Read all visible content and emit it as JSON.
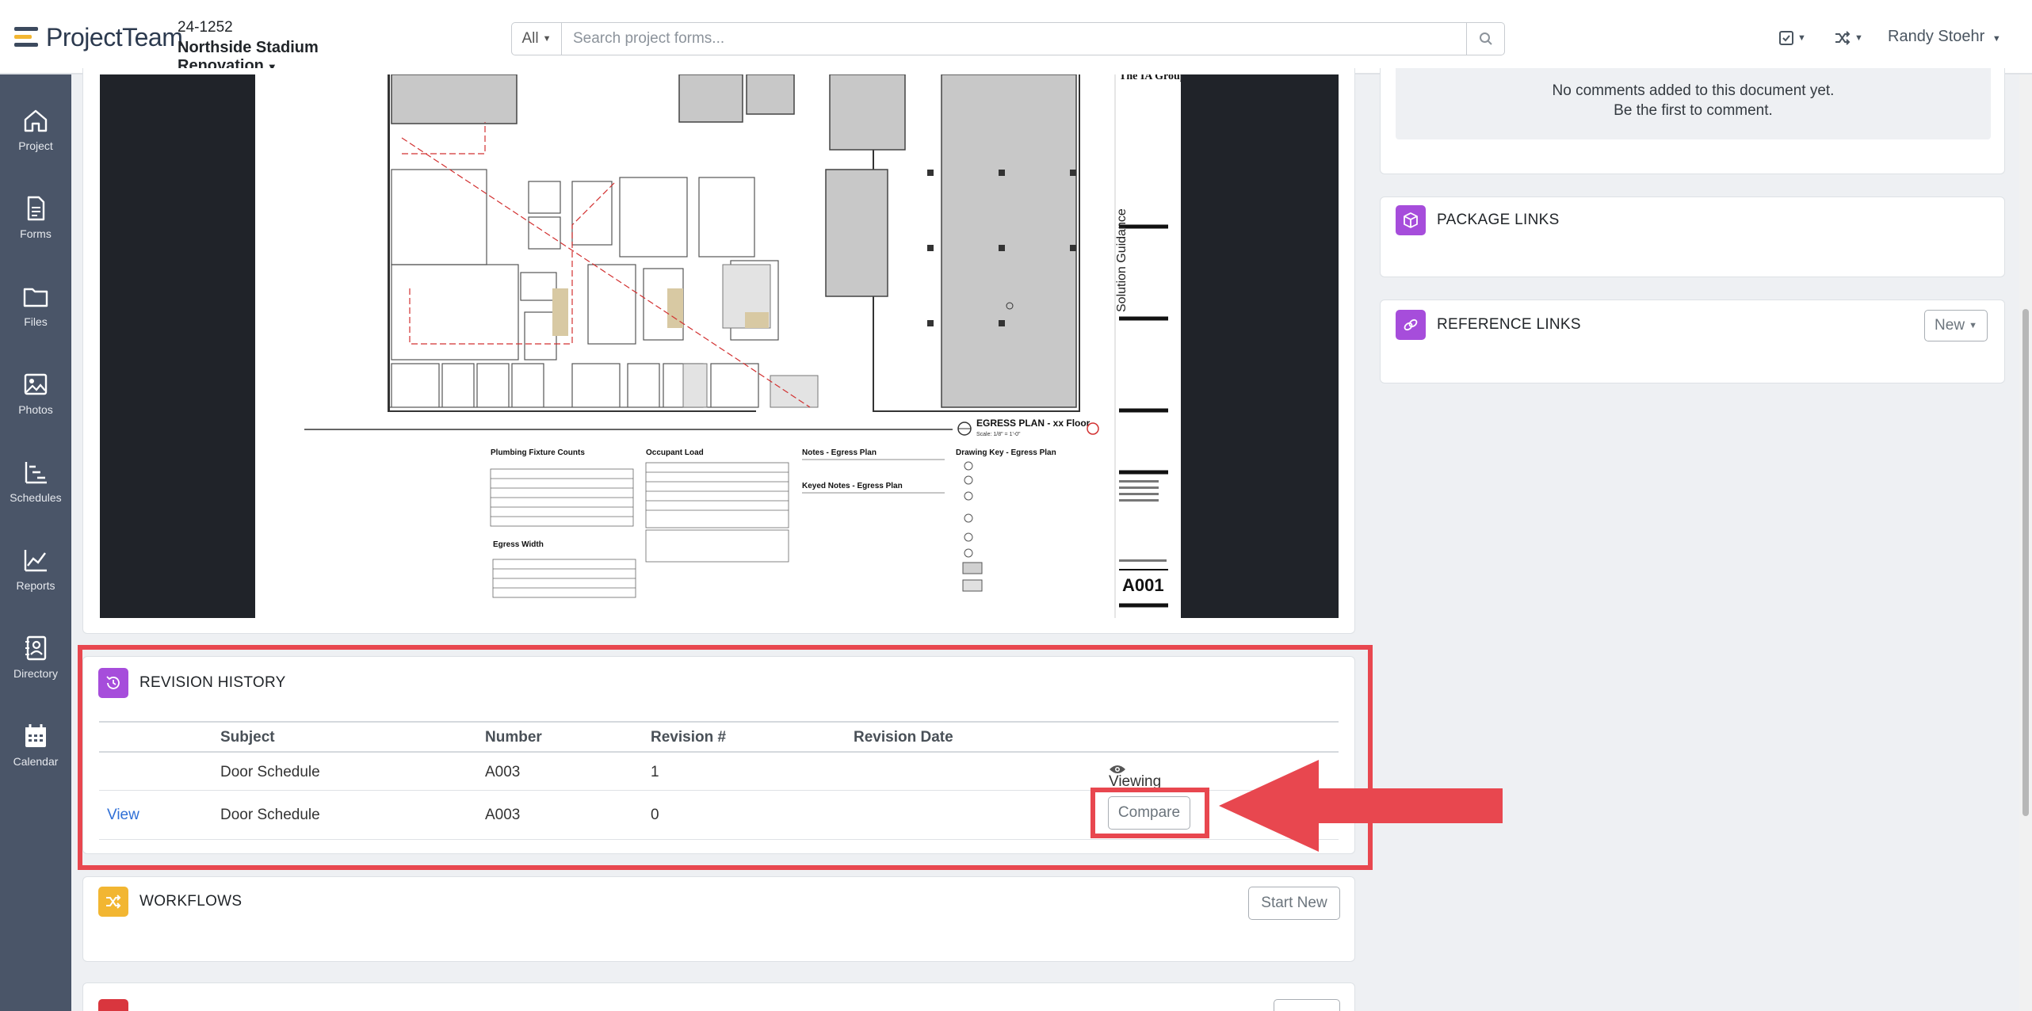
{
  "app": {
    "name": "ProjectTeam"
  },
  "project": {
    "number": "24-1252",
    "name": "Northside Stadium Renovation"
  },
  "search": {
    "filter": "All",
    "placeholder": "Search project forms..."
  },
  "user": {
    "name": "Randy Stoehr"
  },
  "sidebar": {
    "items": [
      {
        "label": "Project",
        "icon": "home-icon"
      },
      {
        "label": "Forms",
        "icon": "document-icon"
      },
      {
        "label": "Files",
        "icon": "folder-icon"
      },
      {
        "label": "Photos",
        "icon": "image-icon"
      },
      {
        "label": "Schedules",
        "icon": "schedule-icon"
      },
      {
        "label": "Reports",
        "icon": "chart-line-icon"
      },
      {
        "label": "Directory",
        "icon": "contact-card-icon"
      },
      {
        "label": "Calendar",
        "icon": "calendar-icon"
      }
    ]
  },
  "drawing": {
    "title": "EGRESS PLAN - xx Floor",
    "scale": "Scale: 1/8\" = 1'-0\"",
    "sheet_number": "A001",
    "firm": "The IA Group",
    "sheet_label": "Solution Guidance",
    "tables": {
      "plumbing": "Plumbing Fixture Counts",
      "occupant": "Occupant Load",
      "egress_width": "Egress Width",
      "notes": "Notes - Egress Plan",
      "keyed_notes": "Keyed Notes - Egress Plan",
      "drawing_key": "Drawing Key - Egress Plan"
    }
  },
  "comments": {
    "empty_line1": "No comments added to this document yet.",
    "empty_line2": "Be the first to comment."
  },
  "package_links": {
    "title": "PACKAGE LINKS"
  },
  "reference_links": {
    "title": "REFERENCE LINKS",
    "new_label": "New"
  },
  "revision_history": {
    "title": "REVISION HISTORY",
    "columns": [
      "Subject",
      "Number",
      "Revision #",
      "Revision Date"
    ],
    "rows": [
      {
        "action": "",
        "subject": "Door Schedule",
        "number": "A003",
        "revision": "1",
        "date": "",
        "status": "Viewing"
      },
      {
        "action": "View",
        "subject": "Door Schedule",
        "number": "A003",
        "revision": "0",
        "date": "",
        "status": "Compare"
      }
    ]
  },
  "workflows": {
    "title": "WORKFLOWS",
    "start_label": "Start New"
  },
  "colors": {
    "accent": "#f2b632",
    "sidebar": "#4a5568",
    "annotation": "#e8474f",
    "purple": "#a64ddb"
  }
}
